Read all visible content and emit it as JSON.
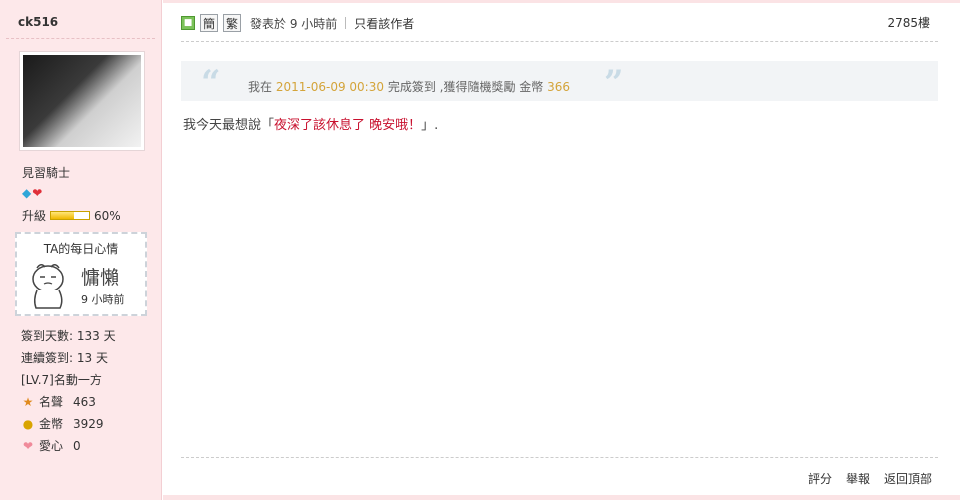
{
  "author": {
    "username": "ck516",
    "rank": "見習騎士",
    "level_label": "升級",
    "level_progress": 0.6,
    "level_percent": "60%"
  },
  "mood": {
    "title": "TA的每日心情",
    "name": "慵懶",
    "time": "9 小時前"
  },
  "stats": {
    "checkin_days": "簽到天數: 133 天",
    "streak": "連續簽到: 13 天",
    "level_title": "[LV.7]名動一方",
    "reputation_label": "名聲",
    "reputation_value": "463",
    "gold_label": "金幣",
    "gold_value": "3929",
    "love_label": "愛心",
    "love_value": "0"
  },
  "header": {
    "simplified_label": "簡",
    "traditional_label": "繁",
    "posted_time": "發表於 9 小時前",
    "author_only": "只看該作者",
    "floor": "2785樓"
  },
  "quote": {
    "prefix": "我在",
    "datetime": "2011-06-09 00:30",
    "middle": "完成簽到 ,獲得隨機獎勵 金幣",
    "amount": "366"
  },
  "content": {
    "prefix": "我今天最想說「",
    "highlight": "夜深了該休息了 晚安哦！",
    "suffix": "」."
  },
  "footer": {
    "rate": "評分",
    "report": "舉報",
    "back_to_top": "返回頂部"
  },
  "colors": {
    "sidebar_bg": "#fde8ea",
    "highlight_gold": "#d4a43a",
    "content_red": "#c8102e"
  }
}
